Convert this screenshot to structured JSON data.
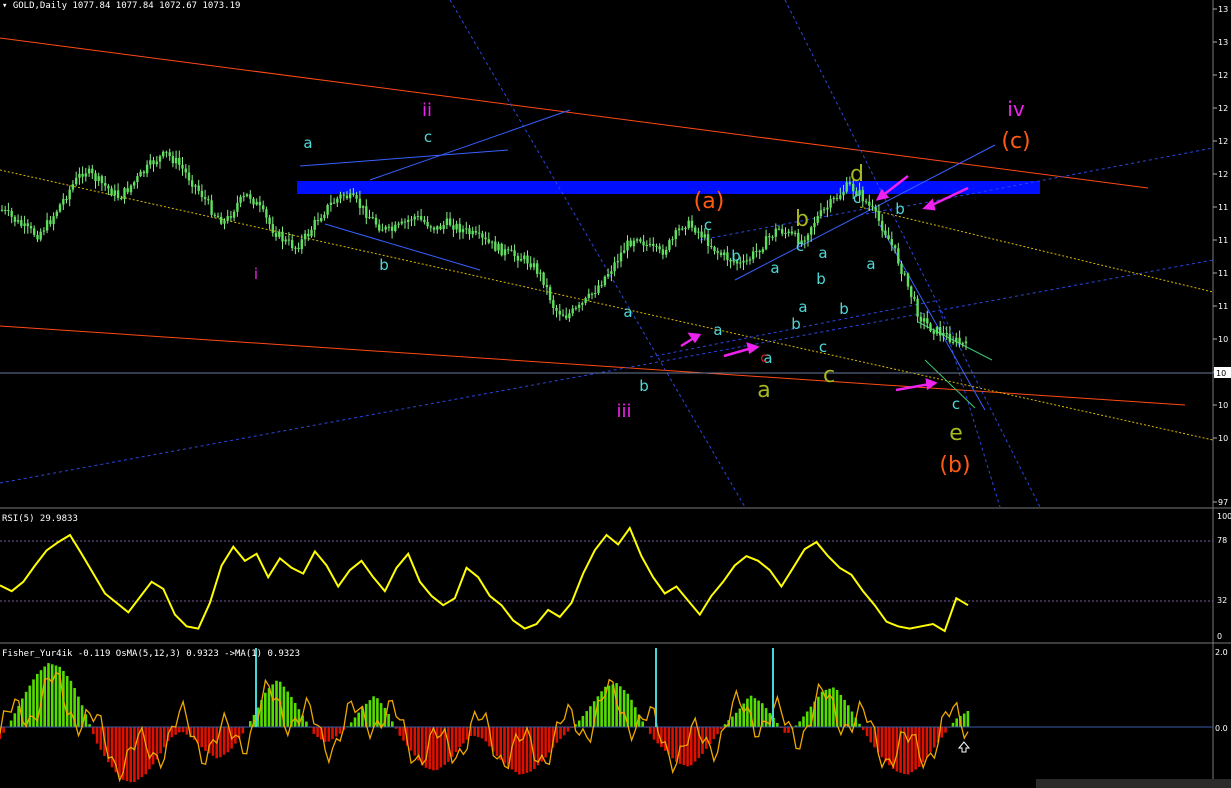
{
  "header": {
    "symbol": "GOLD,Daily",
    "ohlc": "1077.84 1077.84 1072.67 1073.19",
    "rsi": "RSI(5) 29.9833",
    "fisher": "Fisher_Yur4ik -0.119 OsMA(5,12,3) 0.9323 ->MA(1) 0.9323"
  },
  "colors": {
    "background": "#000000",
    "price": "#5ee05e",
    "resistance_zone": "#0010ff",
    "rsi": "#ffff00",
    "osma_up": "#55dd00",
    "osma_down": "#dd1100",
    "fisher": "#f0a800",
    "wave_cyan": "#4fd8d8",
    "wave_magenta": "#ee22ee",
    "wave_orange": "#ff5a14",
    "wave_olive": "#a8b820"
  },
  "main_axis": {
    "ticks": [
      "13",
      "13",
      "12",
      "12",
      "12",
      "12",
      "11",
      "11",
      "11",
      "11",
      "10",
      "10",
      "10",
      "10",
      "97"
    ]
  },
  "rsi_axis": {
    "ticks": [
      "100",
      "78",
      "32",
      "0"
    ]
  },
  "fisher_axis": {
    "ticks": [
      "2.0",
      "0.0"
    ]
  },
  "wave_labels": [
    {
      "text": "a",
      "color": "cyan"
    },
    {
      "text": "ii",
      "color": "magenta"
    },
    {
      "text": "c",
      "color": "cyan"
    },
    {
      "text": "b",
      "color": "cyan"
    },
    {
      "text": "i",
      "color": "magenta"
    },
    {
      "text": "(a)",
      "color": "orange"
    },
    {
      "text": "c",
      "color": "cyan"
    },
    {
      "text": "b",
      "color": "olive"
    },
    {
      "text": "d",
      "color": "olive"
    },
    {
      "text": "c",
      "color": "cyan"
    },
    {
      "text": "b",
      "color": "cyan"
    },
    {
      "text": "iv",
      "color": "magenta"
    },
    {
      "text": "(c)",
      "color": "orange"
    },
    {
      "text": "b",
      "color": "cyan"
    },
    {
      "text": "c",
      "color": "cyan"
    },
    {
      "text": "a",
      "color": "cyan"
    },
    {
      "text": "a",
      "color": "cyan"
    },
    {
      "text": "b",
      "color": "cyan"
    },
    {
      "text": "a",
      "color": "cyan"
    },
    {
      "text": "a",
      "color": "cyan"
    },
    {
      "text": "b",
      "color": "cyan"
    },
    {
      "text": "b",
      "color": "cyan"
    },
    {
      "text": "a",
      "color": "cyan"
    },
    {
      "text": "a",
      "color": "cyan"
    },
    {
      "text": "a",
      "color": "cyan"
    },
    {
      "text": "c",
      "color": "red"
    },
    {
      "text": "c",
      "color": "cyan"
    },
    {
      "text": "b",
      "color": "cyan"
    },
    {
      "text": "iii",
      "color": "magenta"
    },
    {
      "text": "a",
      "color": "olive"
    },
    {
      "text": "c",
      "color": "olive"
    },
    {
      "text": "c",
      "color": "cyan"
    },
    {
      "text": "e",
      "color": "olive"
    },
    {
      "text": "(b)",
      "color": "orange"
    }
  ],
  "chart_data": [
    {
      "type": "line",
      "title": "GOLD,Daily",
      "series": [
        {
          "values": [
            50,
            47,
            44,
            42,
            46,
            52,
            58,
            63,
            60,
            57,
            54,
            58,
            62,
            66,
            68,
            65,
            60,
            55,
            49,
            46,
            52,
            55,
            50,
            44,
            40,
            38,
            42,
            48,
            52,
            55,
            53,
            49,
            45,
            43,
            45,
            48,
            46,
            44,
            46,
            44,
            42,
            40,
            38,
            36,
            35,
            33,
            28,
            18,
            16,
            18,
            22,
            27,
            32,
            38,
            42,
            38,
            36,
            40,
            46,
            44,
            40,
            36,
            34,
            32,
            36,
            40,
            44,
            42,
            40,
            46,
            50,
            54,
            58,
            55,
            50,
            44,
            36,
            26,
            16,
            12,
            10,
            8,
            6
          ]
        }
      ]
    },
    {
      "type": "line",
      "title": "RSI(5) 29.9833",
      "ylim": [
        0,
        100
      ],
      "series": [
        {
          "values": [
            45,
            40,
            48,
            62,
            75,
            82,
            88,
            72,
            55,
            38,
            30,
            22,
            35,
            48,
            42,
            20,
            10,
            8,
            30,
            62,
            78,
            66,
            72,
            52,
            68,
            60,
            55,
            74,
            62,
            44,
            58,
            66,
            52,
            40,
            60,
            72,
            48,
            36,
            28,
            34,
            60,
            52,
            36,
            28,
            15,
            8,
            12,
            24,
            18,
            30,
            55,
            75,
            88,
            80,
            94,
            70,
            52,
            38,
            44,
            32,
            20,
            36,
            48,
            62,
            70,
            66,
            58,
            44,
            60,
            76,
            82,
            70,
            60,
            54,
            40,
            28,
            14,
            10,
            8,
            10,
            12,
            6,
            34,
            28
          ]
        }
      ]
    },
    {
      "type": "bar",
      "title": "Fisher_Yur4ik -0.119 OsMA(5,12,3) 0.9323 ->MA(1) 0.9323",
      "ylim": [
        -2,
        2
      ],
      "series": [
        {
          "values": [
            -0.3,
            0.2,
            0.8,
            1.3,
            1.6,
            1.5,
            1.1,
            0.4,
            -0.4,
            -0.9,
            -1.3,
            -1.4,
            -1.2,
            -0.8,
            -0.3,
            -0.1,
            -0.3,
            -0.6,
            -0.8,
            -0.6,
            -0.2,
            0.3,
            0.9,
            1.2,
            0.8,
            0.3,
            -0.2,
            -0.4,
            -0.2,
            0.1,
            0.5,
            0.8,
            0.4,
            -0.2,
            -0.6,
            -1.0,
            -1.1,
            -0.9,
            -0.5,
            -0.2,
            -0.3,
            -0.7,
            -1.0,
            -1.2,
            -1.1,
            -0.8,
            -0.4,
            -0.1,
            0.2,
            0.6,
            1.0,
            1.1,
            0.8,
            0.2,
            -0.3,
            -0.6,
            -0.9,
            -1.0,
            -0.7,
            -0.3,
            0.1,
            0.4,
            0.8,
            0.6,
            0.2,
            -0.2,
            0.1,
            0.5,
            0.9,
            1.0,
            0.6,
            0.1,
            -0.4,
            -0.8,
            -1.1,
            -1.2,
            -1.0,
            -0.6,
            -0.2,
            0.2,
            0.4
          ]
        }
      ]
    }
  ]
}
